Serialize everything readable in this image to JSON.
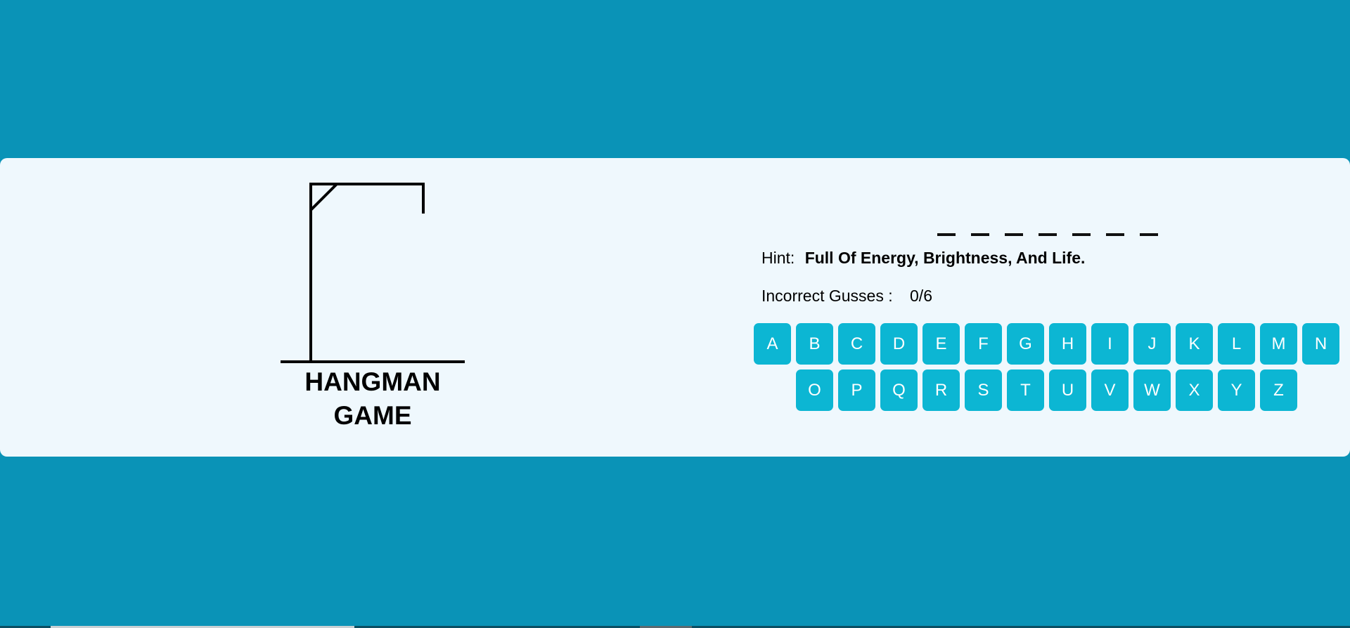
{
  "game": {
    "title_line1": "HANGMAN",
    "title_line2": "GAME"
  },
  "word": {
    "blanks": [
      "",
      "",
      "",
      "",
      "",
      "",
      ""
    ]
  },
  "hint": {
    "label": "Hint:",
    "text": "Full Of Energy, Brightness, And Life."
  },
  "guesses": {
    "label": "Incorrect Gusses :",
    "value": "0/6"
  },
  "keyboard": {
    "row1": [
      "A",
      "B",
      "C",
      "D",
      "E",
      "F",
      "G",
      "H",
      "I",
      "J",
      "K",
      "L",
      "M",
      "N"
    ],
    "row2": [
      "O",
      "P",
      "Q",
      "R",
      "S",
      "T",
      "U",
      "V",
      "W",
      "X",
      "Y",
      "Z"
    ]
  },
  "colors": {
    "background": "#0a93b7",
    "card": "#eff8fd",
    "key": "#0cb6d3",
    "key_text": "#ffffff"
  }
}
